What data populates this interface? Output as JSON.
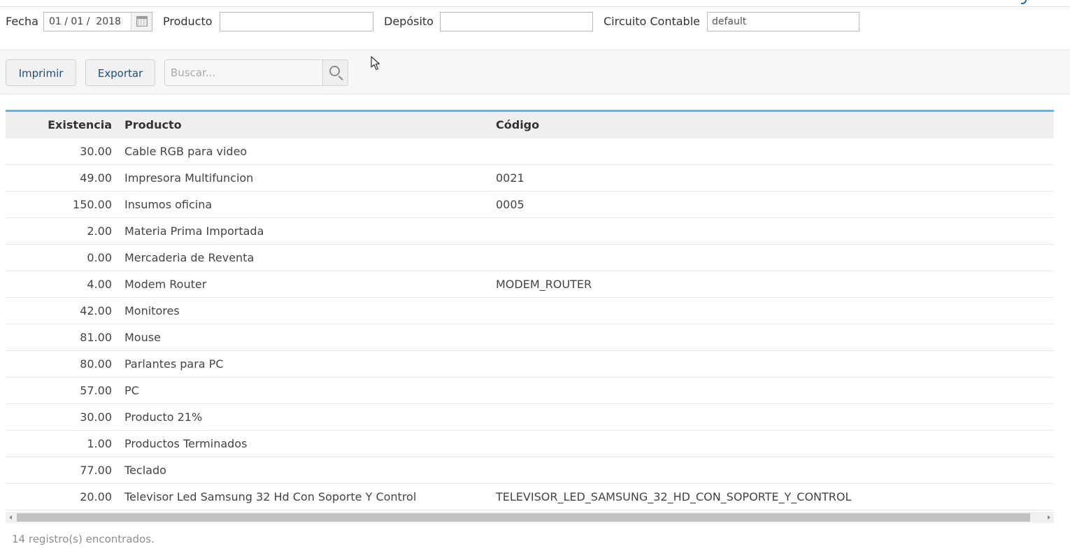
{
  "filters": {
    "fecha_label": "Fecha",
    "fecha_value": "01 / 01 /  2018",
    "producto_label": "Producto",
    "producto_value": "",
    "deposito_label": "Depósito",
    "deposito_value": "",
    "circuito_label": "Circuito Contable",
    "circuito_value": "default"
  },
  "toolbar": {
    "print_label": "Imprimir",
    "export_label": "Exportar",
    "search_placeholder": "Buscar..."
  },
  "table": {
    "headers": {
      "existencia": "Existencia",
      "producto": "Producto",
      "codigo": "Código"
    },
    "rows": [
      {
        "existencia": "30.00",
        "producto": "Cable RGB para video",
        "codigo": ""
      },
      {
        "existencia": "49.00",
        "producto": "Impresora Multifuncion",
        "codigo": "0021"
      },
      {
        "existencia": "150.00",
        "producto": "Insumos oficina",
        "codigo": "0005"
      },
      {
        "existencia": "2.00",
        "producto": "Materia Prima Importada",
        "codigo": ""
      },
      {
        "existencia": "0.00",
        "producto": "Mercaderia de Reventa",
        "codigo": ""
      },
      {
        "existencia": "4.00",
        "producto": "Modem Router",
        "codigo": "MODEM_ROUTER"
      },
      {
        "existencia": "42.00",
        "producto": "Monitores",
        "codigo": ""
      },
      {
        "existencia": "81.00",
        "producto": "Mouse",
        "codigo": ""
      },
      {
        "existencia": "80.00",
        "producto": "Parlantes para PC",
        "codigo": ""
      },
      {
        "existencia": "57.00",
        "producto": "PC",
        "codigo": ""
      },
      {
        "existencia": "30.00",
        "producto": "Producto 21%",
        "codigo": ""
      },
      {
        "existencia": "1.00",
        "producto": "Productos Terminados",
        "codigo": ""
      },
      {
        "existencia": "77.00",
        "producto": "Teclado",
        "codigo": ""
      },
      {
        "existencia": "20.00",
        "producto": "Televisor Led Samsung 32 Hd Con Soporte Y Control",
        "codigo": "TELEVISOR_LED_SAMSUNG_32_HD_CON_SOPORTE_Y_CONTROL"
      }
    ]
  },
  "footer": {
    "count_text": "14 registro(s) encontrados."
  },
  "icons": {
    "calendar": "calendar-icon",
    "search": "search-icon",
    "cursor": "mouse-pointer-icon"
  },
  "colors": {
    "table_accent": "#5db6e6",
    "button_text": "#1f4e79"
  }
}
